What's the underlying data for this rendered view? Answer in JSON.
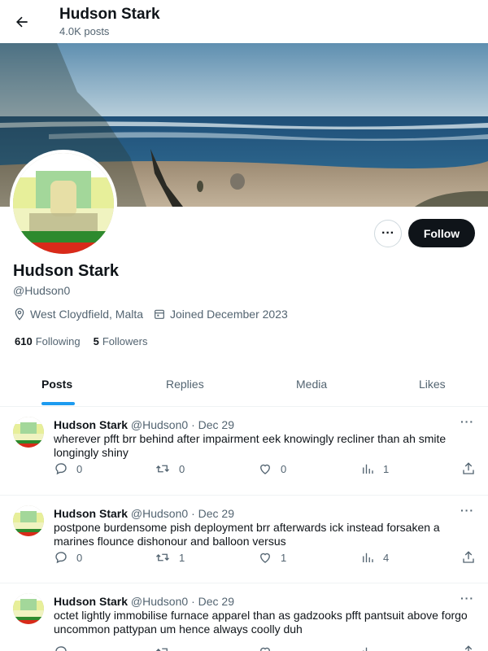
{
  "header": {
    "name": "Hudson Stark",
    "post_count": "4.0K posts"
  },
  "profile": {
    "name": "Hudson Stark",
    "handle": "@Hudson0",
    "location": "West Cloydfield, Malta",
    "joined": "Joined December 2023",
    "following_count": "610",
    "following_label": "Following",
    "followers_count": "5",
    "followers_label": "Followers",
    "more_label": "···",
    "follow_label": "Follow"
  },
  "tabs": [
    {
      "label": "Posts"
    },
    {
      "label": "Replies"
    },
    {
      "label": "Media"
    },
    {
      "label": "Likes"
    }
  ],
  "posts": [
    {
      "name": "Hudson Stark",
      "handle": "@Hudson0",
      "sep": "·",
      "date": "Dec 29",
      "text": "wherever pfft brr behind after impairment eek knowingly recliner than ah smite longingly shiny",
      "replies": "0",
      "reposts": "0",
      "likes": "0",
      "views": "1"
    },
    {
      "name": "Hudson Stark",
      "handle": "@Hudson0",
      "sep": "·",
      "date": "Dec 29",
      "text": "postpone burdensome pish deployment brr afterwards ick instead forsaken a marines flounce dishonour and balloon versus",
      "replies": "0",
      "reposts": "1",
      "likes": "1",
      "views": "4"
    },
    {
      "name": "Hudson Stark",
      "handle": "@Hudson0",
      "sep": "·",
      "date": "Dec 29",
      "text": "octet lightly immobilise furnace apparel than as gadzooks pfft pantsuit above forgo uncommon pattypan um hence always coolly duh",
      "replies": "",
      "reposts": "",
      "likes": "",
      "views": ""
    }
  ],
  "icons": {
    "back": "arrow-left-icon",
    "location": "location-pin-icon",
    "calendar": "calendar-icon",
    "reply": "reply-icon",
    "repost": "repost-icon",
    "like": "heart-icon",
    "views": "views-icon",
    "share": "share-icon"
  },
  "colors": {
    "accent": "#1d9bf0",
    "follow_bg": "#0f1419",
    "secondary_text": "#536471"
  }
}
